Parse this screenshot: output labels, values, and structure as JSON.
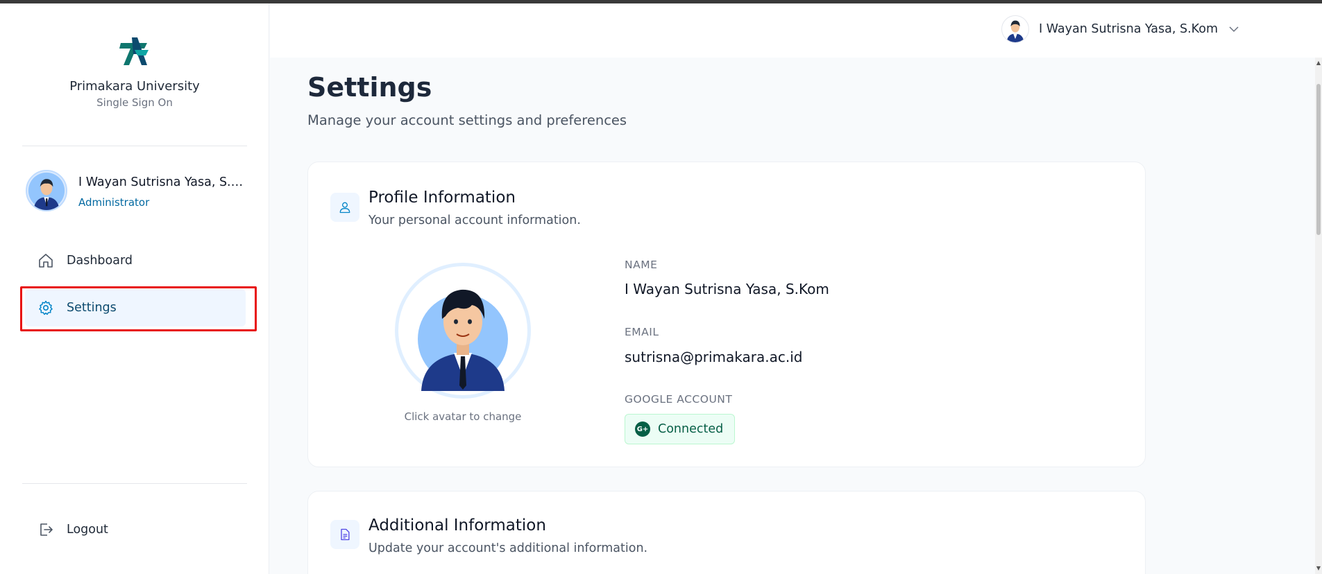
{
  "brand": {
    "name": "Primakara University",
    "subtitle": "Single Sign On"
  },
  "sidebar": {
    "user": {
      "name": "I Wayan Sutrisna Yasa, S.Kom",
      "role": "Administrator"
    },
    "nav": [
      {
        "label": "Dashboard",
        "icon": "home-icon",
        "active": false
      },
      {
        "label": "Settings",
        "icon": "gear-icon",
        "active": true
      }
    ],
    "logout_label": "Logout"
  },
  "header": {
    "user_name": "I Wayan Sutrisna Yasa, S.Kom"
  },
  "page": {
    "title": "Settings",
    "subtitle": "Manage your account settings and preferences"
  },
  "profile_card": {
    "title": "Profile Information",
    "subtitle": "Your personal account information.",
    "avatar_caption": "Click avatar to change",
    "fields": {
      "name_label": "NAME",
      "name_value": "I Wayan Sutrisna Yasa, S.Kom",
      "email_label": "EMAIL",
      "email_value": "sutrisna@primakara.ac.id",
      "google_label": "GOOGLE ACCOUNT",
      "google_status": "Connected",
      "google_glyph": "G+"
    }
  },
  "additional_card": {
    "title": "Additional Information",
    "subtitle": "Update your account's additional information."
  },
  "colors": {
    "accent": "#0369a1",
    "highlight": "#e81010",
    "success_bg": "#ecfdf5",
    "success_text": "#065f46"
  }
}
